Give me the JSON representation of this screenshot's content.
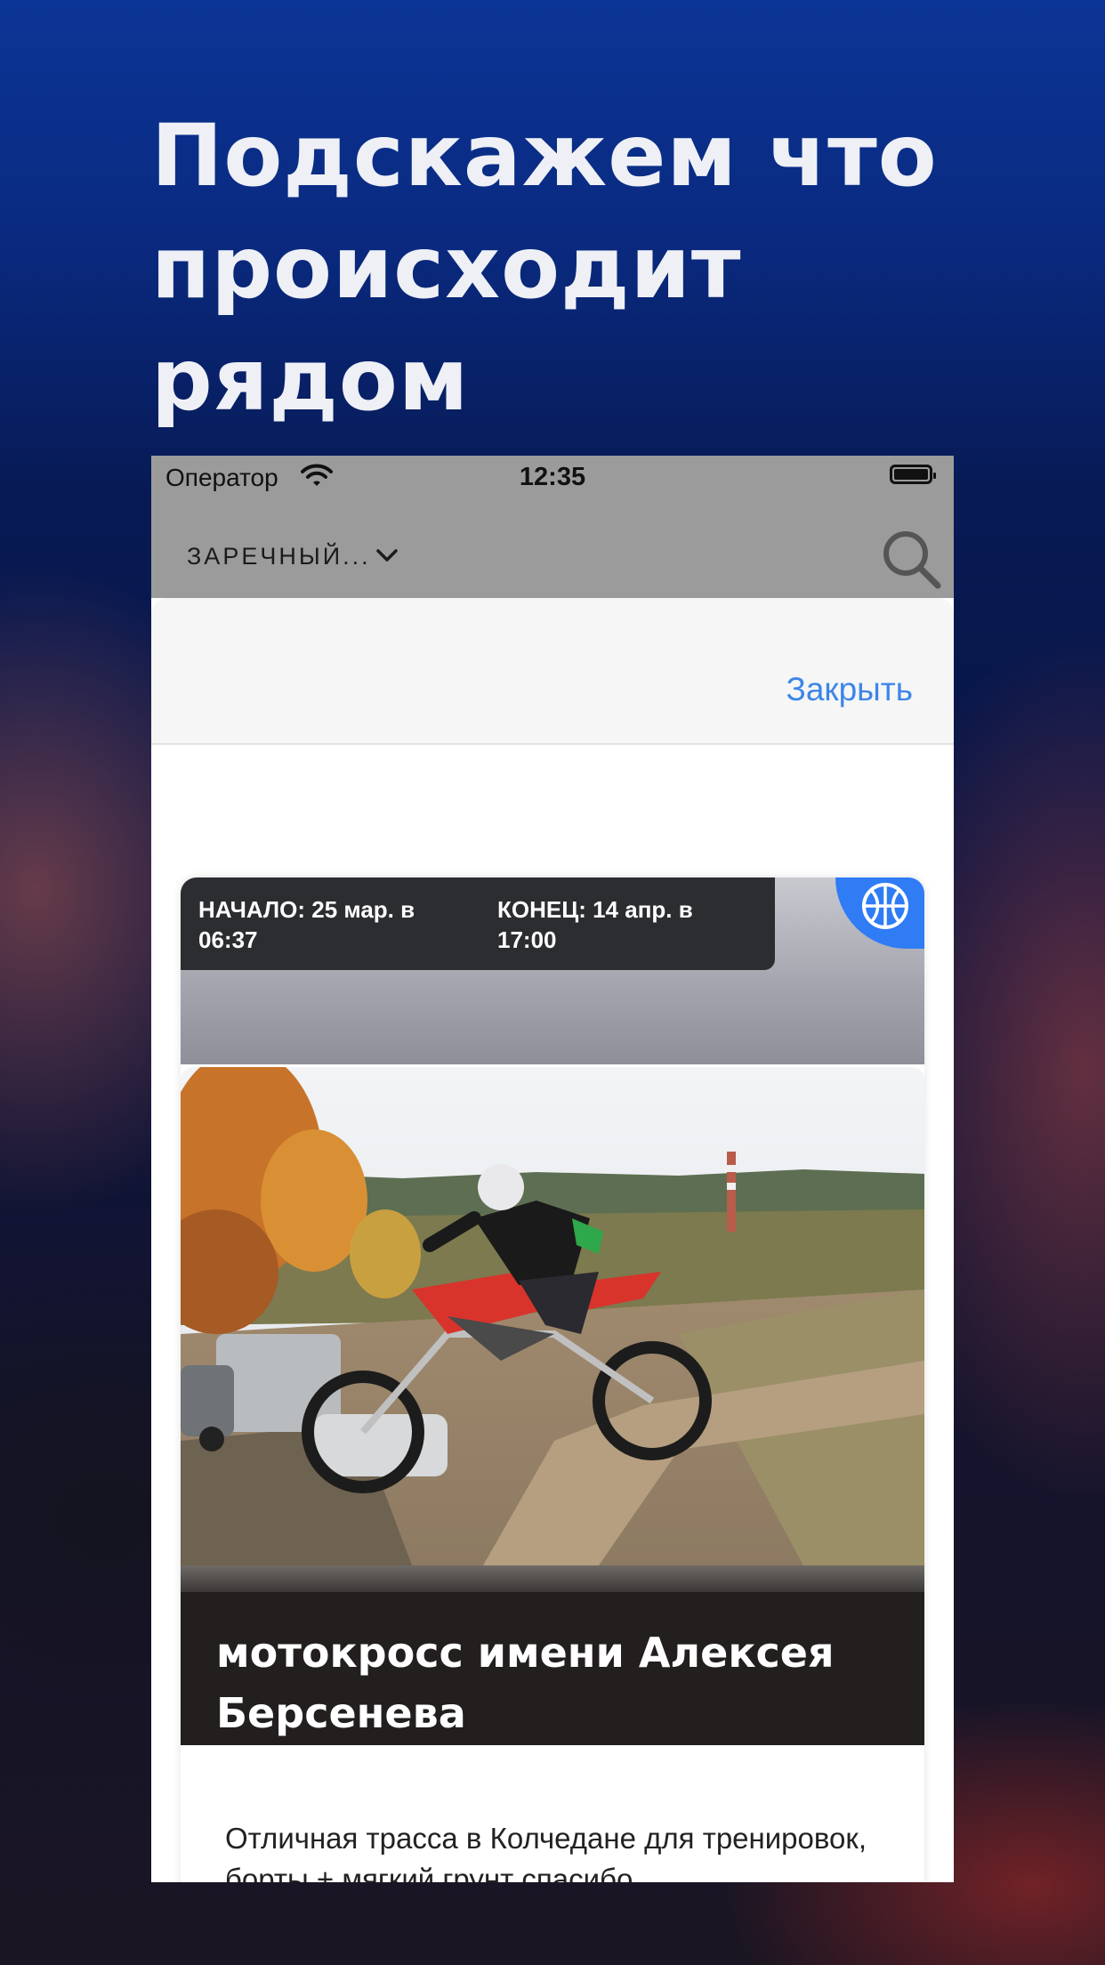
{
  "promo": {
    "headline_line1": "Подскажем что",
    "headline_line2": "происходит рядом"
  },
  "statusbar": {
    "carrier": "Оператор",
    "time": "12:35"
  },
  "navbar": {
    "city": "ЗАРЕЧНЫЙ..."
  },
  "sheet": {
    "close_label": "Закрыть"
  },
  "event": {
    "start": "НАЧАЛО: 25 мар. в 06:37",
    "end": "КОНЕЦ: 14 апр. в 17:00",
    "title": "мотокросс имени Алексея Берсенева",
    "description": "Отличная трасса в Колчедане для тренировок, борты + мягкий грунт спасибо"
  },
  "colors": {
    "accent": "#3d86e8",
    "badge": "#2f7cf5"
  }
}
